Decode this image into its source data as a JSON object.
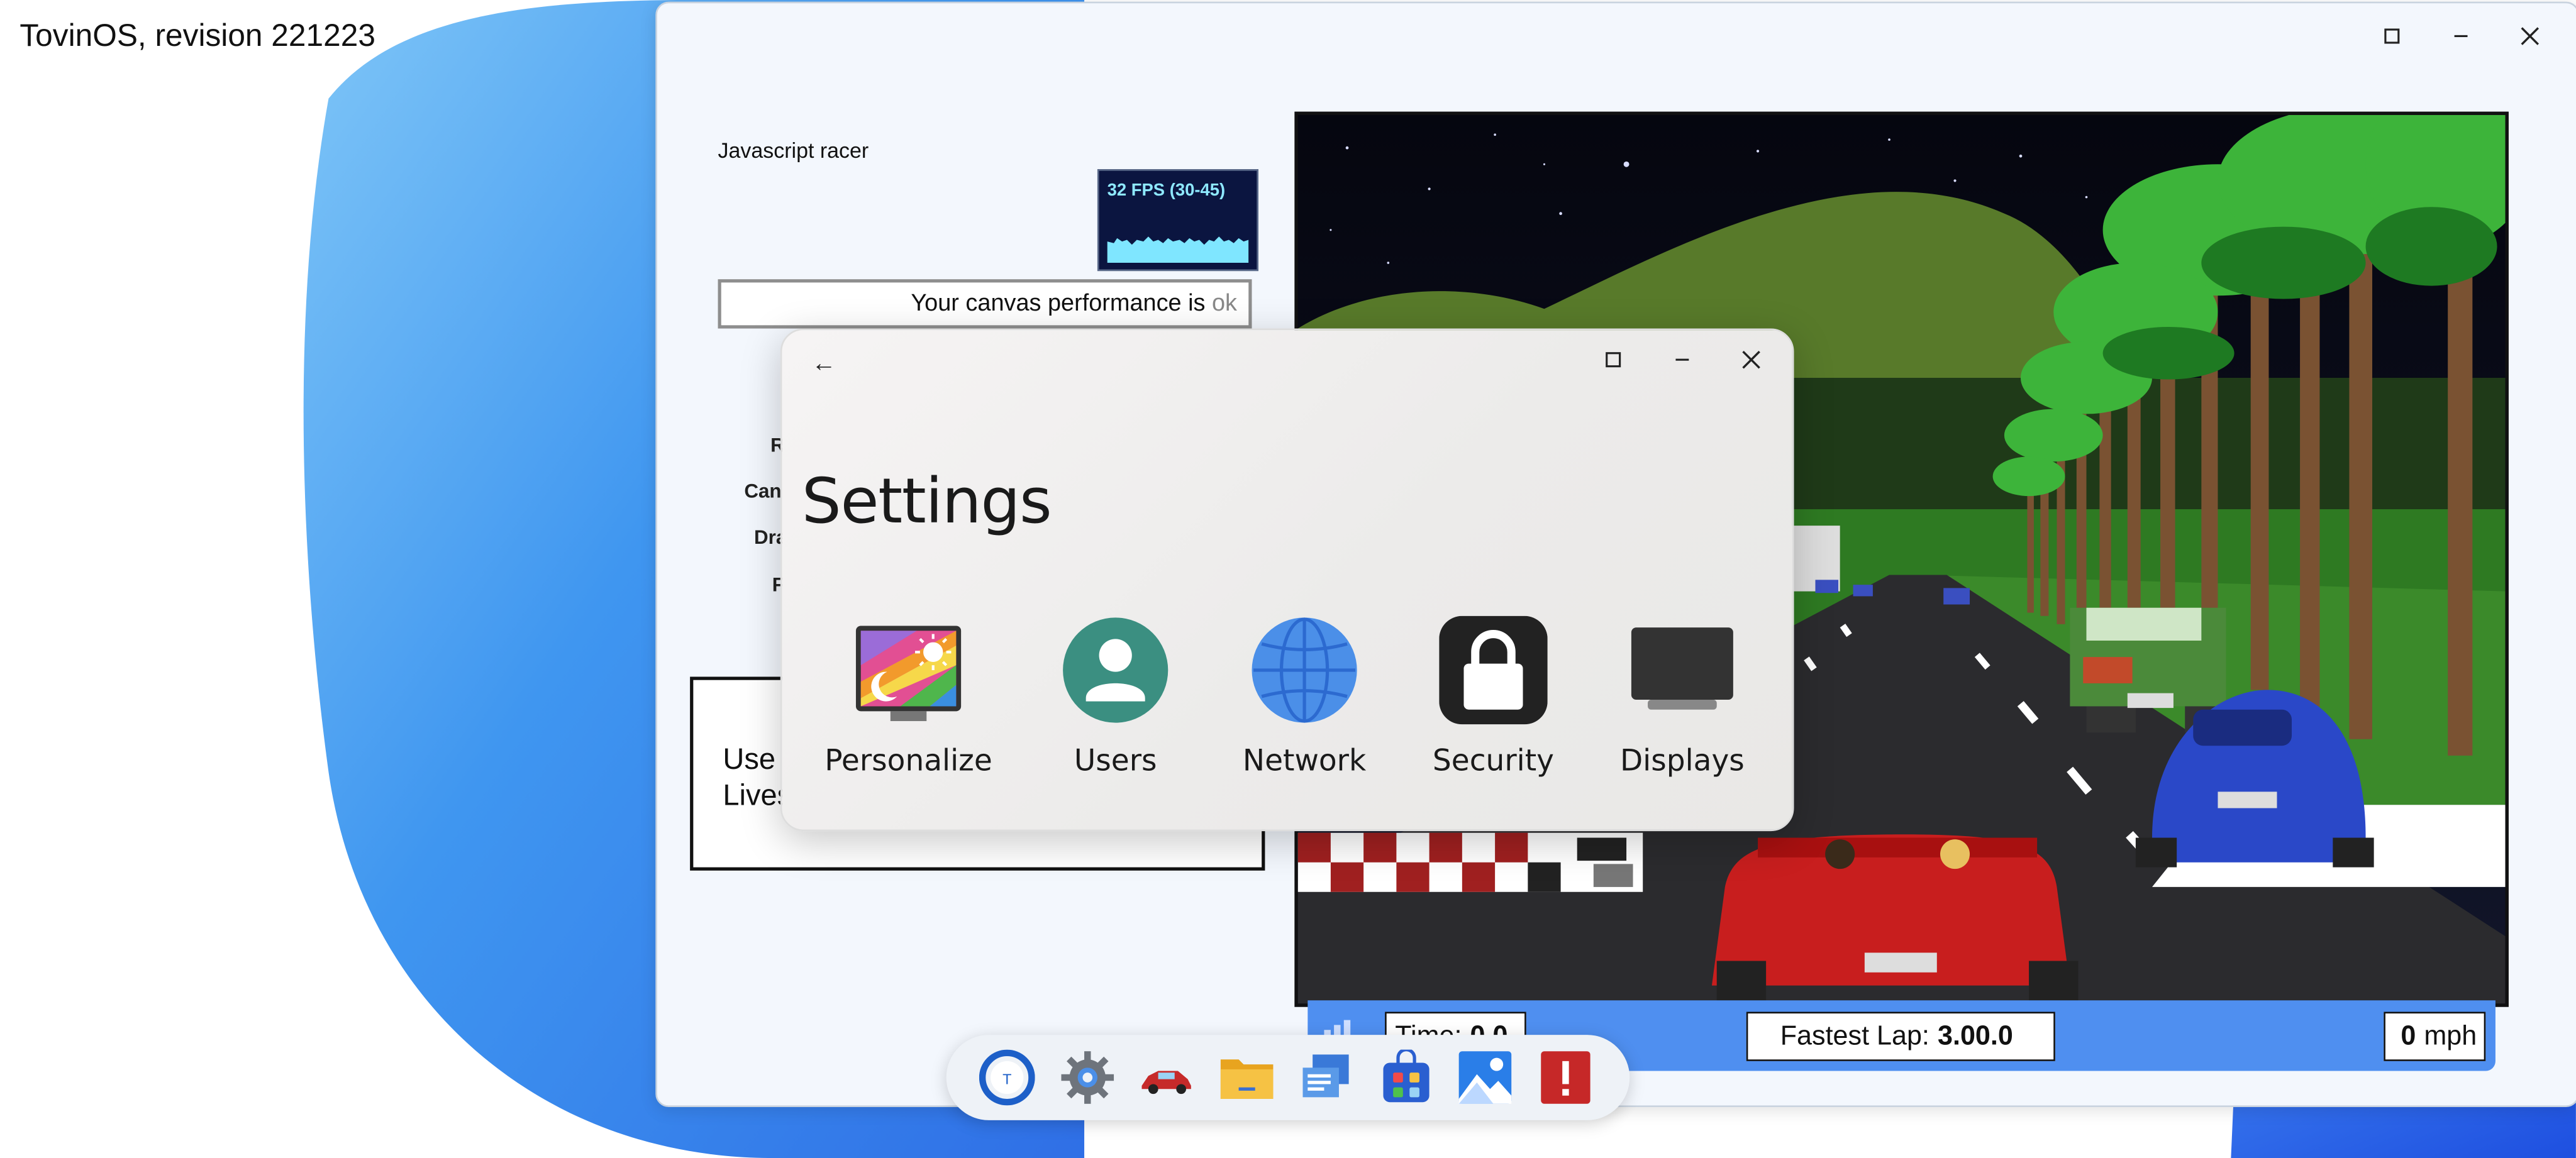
{
  "os": {
    "title": "TovinOS, revision 221223"
  },
  "app_window": {
    "controls": {
      "maximize_icon": "maximize-icon",
      "minimize_icon": "minimize-icon",
      "close_icon": "close-icon"
    },
    "racer_title": "Javascript racer",
    "fps": {
      "label": "32 FPS (30-45)",
      "fps_value": 32
    },
    "performance": {
      "prefix": "Your canvas performance is",
      "status": "ok"
    },
    "side_labels": [
      "R",
      "Can",
      "Dra",
      "F"
    ],
    "lives_box": {
      "line1": "Use",
      "line2": "Lives"
    }
  },
  "game_hud": {
    "time_label": "Time:",
    "time_value": "0.0",
    "fastest_lap_label": "Fastest Lap:",
    "fastest_lap_value": "3.00.0",
    "speed_value": "0",
    "speed_unit": "mph"
  },
  "settings": {
    "back_label": "←",
    "title": "Settings",
    "items": [
      {
        "label": "Personalize",
        "icon": "personalize-icon"
      },
      {
        "label": "Users",
        "icon": "user-icon"
      },
      {
        "label": "Network",
        "icon": "globe-icon"
      },
      {
        "label": "Security",
        "icon": "lock-icon"
      },
      {
        "label": "Displays",
        "icon": "monitor-icon"
      }
    ]
  },
  "taskbar": {
    "icons": [
      "tovin-launcher-icon",
      "settings-gear-icon",
      "racer-car-icon",
      "files-folder-icon",
      "notes-icon",
      "app-store-icon",
      "photos-icon",
      "alert-icon"
    ]
  },
  "colors": {
    "wallpaper_blue": "#3f96f0",
    "hud_blue": "#4f8ff0",
    "fps_bg": "#0b1540",
    "fps_graph": "#7fe6ff"
  }
}
